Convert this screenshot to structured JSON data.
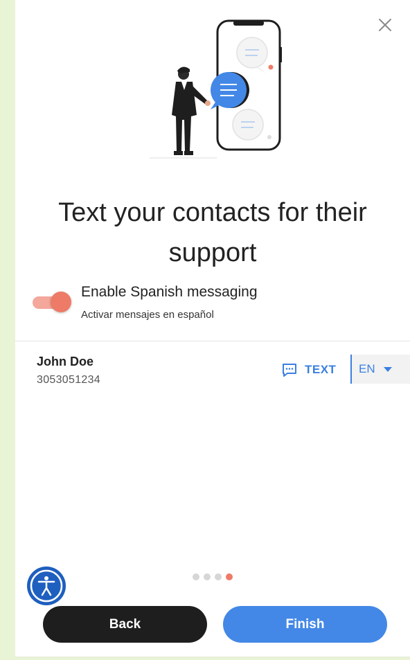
{
  "dialog": {
    "title": "Text your contacts for their support",
    "close_icon": "close-icon",
    "illustration_icon": "person-texting-phone-illustration"
  },
  "spanish_toggle": {
    "label": "Enable Spanish messaging",
    "sublabel": "Activar mensajes en español",
    "enabled": true,
    "color": "#ee7b67"
  },
  "contact": {
    "name": "John Doe",
    "phone": "3053051234",
    "text_button_label": "TEXT",
    "text_icon": "message-icon",
    "language": "EN"
  },
  "pager": {
    "total": 4,
    "current": 4
  },
  "footer": {
    "back_label": "Back",
    "finish_label": "Finish"
  },
  "colors": {
    "accent": "#4388e6",
    "secondary": "#ee7b67",
    "dark": "#1e1e1e",
    "page_bg": "#e9f3d6"
  }
}
